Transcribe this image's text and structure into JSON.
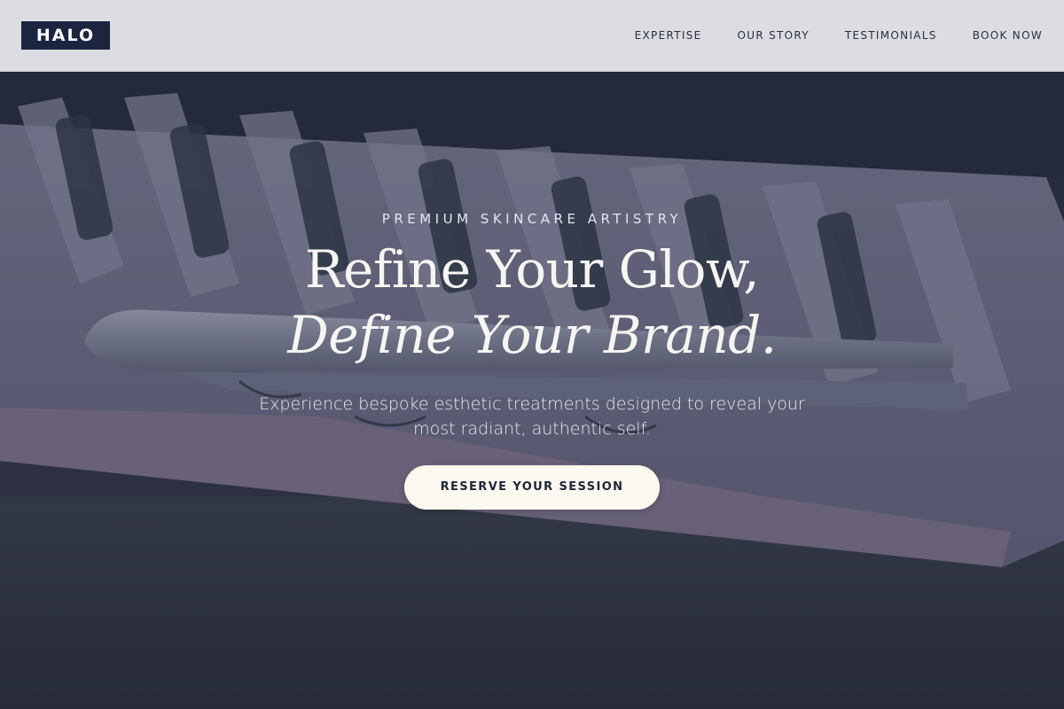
{
  "header": {
    "logo_text": "HALO",
    "nav": [
      {
        "label": "EXPERTISE"
      },
      {
        "label": "OUR STORY"
      },
      {
        "label": "TESTIMONIALS"
      },
      {
        "label": "BOOK NOW"
      }
    ]
  },
  "hero": {
    "eyebrow": "PREMIUM SKINCARE ARTISTRY",
    "title_line1": "Refine Your Glow,",
    "title_line2": "Define Your Brand.",
    "subtitle": "Experience bespoke esthetic treatments designed to reveal your most radiant, authentic self.",
    "cta_label": "RESERVE YOUR SESSION",
    "background_image": "eyelash-extension-tray-with-tweezers"
  },
  "colors": {
    "logo_bg": "#1c2540",
    "header_bg": "#e2e4e8",
    "cta_bg": "#fbf8ef",
    "cta_text": "#1f2538",
    "hero_text": "#f6f5f2"
  }
}
